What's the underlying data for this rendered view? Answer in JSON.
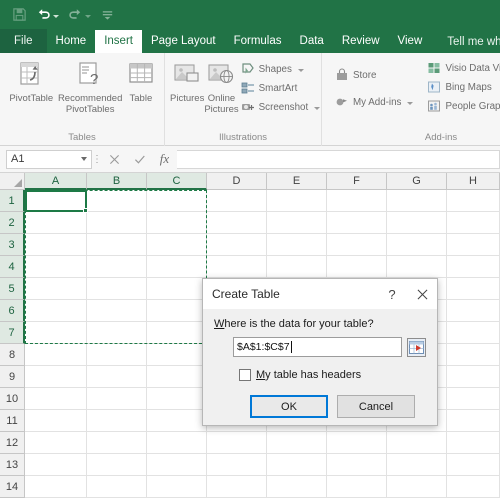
{
  "app": {
    "quick_access": [
      {
        "name": "save-icon",
        "label": "Save",
        "disabled": true
      },
      {
        "name": "undo-icon",
        "label": "Undo",
        "disabled": false,
        "dropdown": true
      },
      {
        "name": "redo-icon",
        "label": "Redo",
        "disabled": true,
        "dropdown": true
      },
      {
        "name": "customize-qat-icon",
        "label": "Customize Quick Access Toolbar",
        "disabled": false
      }
    ]
  },
  "ribbon": {
    "tabs": [
      {
        "label": "File",
        "kind": "file"
      },
      {
        "label": "Home",
        "kind": "normal"
      },
      {
        "label": "Insert",
        "kind": "active"
      },
      {
        "label": "Page Layout",
        "kind": "normal"
      },
      {
        "label": "Formulas",
        "kind": "normal"
      },
      {
        "label": "Data",
        "kind": "normal"
      },
      {
        "label": "Review",
        "kind": "normal"
      },
      {
        "label": "View",
        "kind": "normal"
      }
    ],
    "tell_me": "Tell me what",
    "groups": [
      {
        "title": "Tables",
        "big_buttons": [
          {
            "label": "PivotTable",
            "icon": "pivottable-icon"
          },
          {
            "label": "Recommended PivotTables",
            "icon": "recommended-pivottables-icon"
          },
          {
            "label": "Table",
            "icon": "table-icon"
          }
        ],
        "small_buttons": []
      },
      {
        "title": "Illustrations",
        "big_buttons": [
          {
            "label": "Pictures",
            "icon": "pictures-icon"
          },
          {
            "label": "Online Pictures",
            "icon": "online-pictures-icon"
          }
        ],
        "small_buttons": [
          {
            "label": "Shapes",
            "icon": "shapes-icon",
            "dropdown": true
          },
          {
            "label": "SmartArt",
            "icon": "smartart-icon",
            "dropdown": false
          },
          {
            "label": "Screenshot",
            "icon": "screenshot-icon",
            "dropdown": true
          }
        ]
      },
      {
        "title": "Add-ins",
        "big_buttons": [],
        "small_buttons": [
          {
            "label": "Store",
            "icon": "store-icon",
            "dropdown": false
          },
          {
            "label": "My Add-ins",
            "icon": "my-addins-icon",
            "dropdown": true
          }
        ],
        "small_buttons_2": [
          {
            "label": "Visio Data Visu",
            "icon": "visio-data-visualizer-icon",
            "dropdown": false
          },
          {
            "label": "Bing Maps",
            "icon": "bing-maps-icon",
            "dropdown": false
          },
          {
            "label": "People Graph",
            "icon": "people-graph-icon",
            "dropdown": false
          }
        ]
      }
    ]
  },
  "formula_bar": {
    "name_box_value": "A1",
    "cancel_label": "✕",
    "enter_label": "✓",
    "function_label": "fx",
    "formula_value": ""
  },
  "grid": {
    "columns": [
      "A",
      "B",
      "C",
      "D",
      "E",
      "F",
      "G",
      "H"
    ],
    "selected_columns": [
      "A",
      "B",
      "C"
    ],
    "active_column": "A",
    "rows": [
      "1",
      "2",
      "3",
      "4",
      "5",
      "6",
      "7",
      "8",
      "9",
      "10",
      "11",
      "12",
      "13",
      "14"
    ],
    "selected_rows": [
      "1",
      "2",
      "3",
      "4",
      "5",
      "6",
      "7"
    ],
    "active_cell": "A1",
    "marquee_range": "A1:C7"
  },
  "dialog": {
    "title": "Create Table",
    "help_label": "?",
    "close_label": "✕",
    "prompt_prefix": "W",
    "prompt_rest": "here is the data for your table?",
    "range_value": "$A$1:$C$7",
    "range_picker_name": "range-selector-icon",
    "checkbox_prefix": "M",
    "checkbox_rest": "y table has headers",
    "checkbox_checked": false,
    "ok_label": "OK",
    "cancel_label": "Cancel"
  },
  "colors": {
    "excel_green": "#217346",
    "selection_green": "#1d7a46",
    "focus_blue": "#0078d7"
  }
}
